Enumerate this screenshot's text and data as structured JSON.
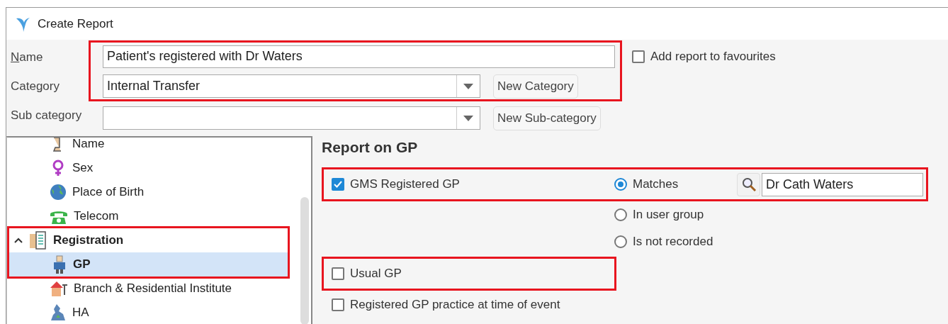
{
  "window": {
    "title": "Create Report"
  },
  "form": {
    "highlighted": true,
    "name": {
      "label": "Name",
      "value": "Patient's registered with Dr Waters"
    },
    "category": {
      "label": "Category",
      "value": "Internal Transfer",
      "button": "New Category"
    },
    "sub_category": {
      "label": "Sub category",
      "button": "New Sub-category"
    },
    "favourites": {
      "label": "Add report to favourites",
      "checked": false
    }
  },
  "tree": [
    {
      "children": [
        {
          "label": "Name",
          "selected": false
        },
        {
          "label": "Sex",
          "selected": false
        },
        {
          "label": "Place of Birth",
          "selected": false
        },
        {
          "label": "Telecom",
          "selected": false
        }
      ]
    },
    {
      "label": "Registration",
      "expanded": true,
      "selected": false,
      "highlighted": true,
      "children": [
        {
          "label": "GP",
          "selected": true
        },
        {
          "label": "Branch & Residential Institute",
          "selected": false
        },
        {
          "label": "HA",
          "selected": false
        }
      ]
    }
  ],
  "panel": {
    "title": "Report on GP",
    "options": [
      {
        "label": "GMS Registered GP",
        "checked": true,
        "highlighted": true,
        "radios": [
          {
            "label": "Matches",
            "selected": true
          },
          {
            "label": "In user group",
            "selected": false
          },
          {
            "label": "Is not recorded",
            "selected": false
          }
        ],
        "search_value": "Dr Cath Waters"
      },
      {
        "label": "Usual GP",
        "checked": false,
        "highlighted": true
      },
      {
        "label": "Registered GP practice at time of event",
        "checked": false,
        "highlighted": false
      }
    ]
  }
}
